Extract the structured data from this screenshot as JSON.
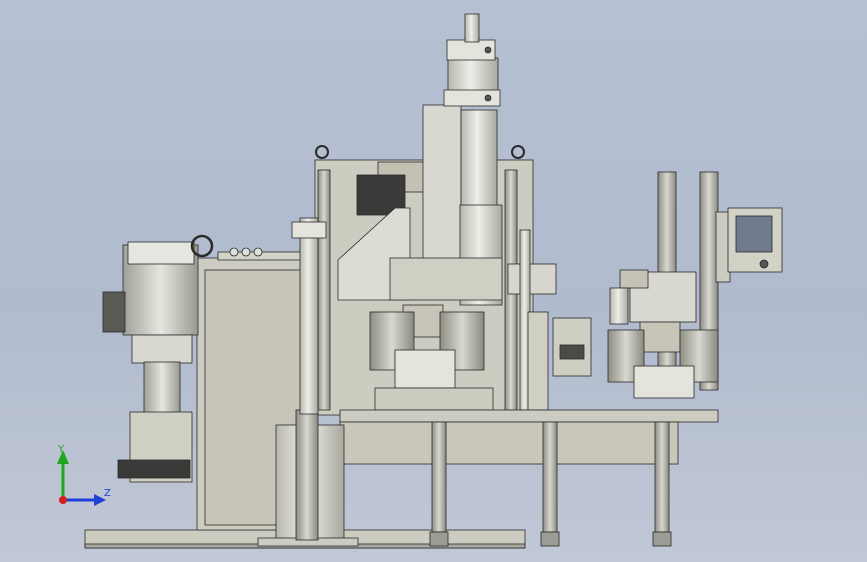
{
  "viewport": {
    "background_top": "#b6c0d3",
    "background_bottom": "#c1c8d6",
    "model_color": "#cdccc0",
    "model_shadow": "#a9a99e",
    "steel_color": "#d7d8d2",
    "edge_color": "#2a2a2a",
    "panel_screen_color": "#6f7a8e"
  },
  "triad": {
    "y_label": "Y",
    "z_label": "Z",
    "y_color": "#1fa81f",
    "z_color": "#1f3fd8",
    "x_color": "#d42020",
    "icon": "coordinate-triad-icon"
  }
}
